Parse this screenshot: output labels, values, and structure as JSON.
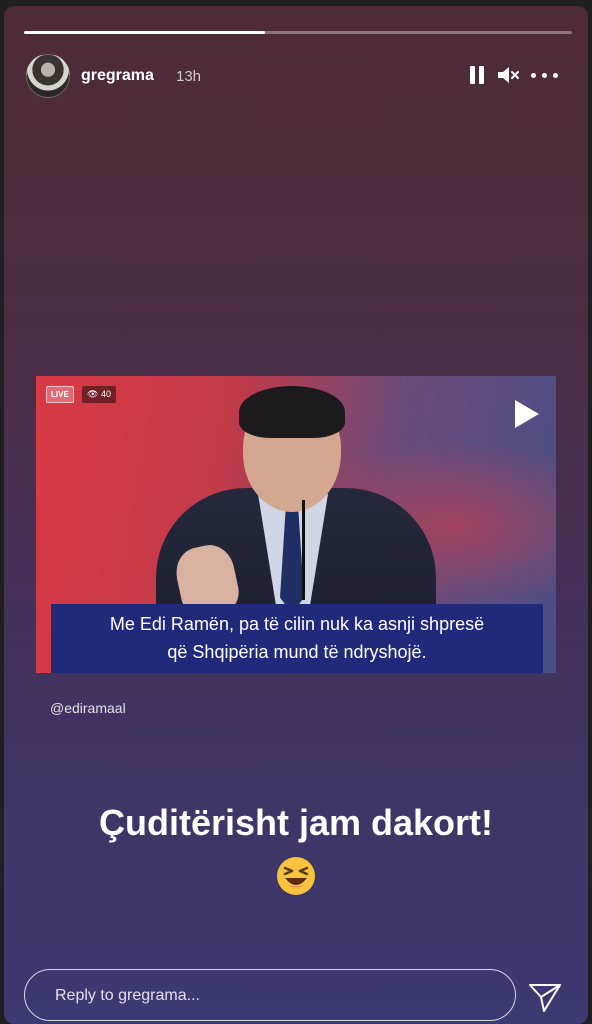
{
  "story": {
    "progress": 0.44,
    "username": "gregrama",
    "time_ago": "13h"
  },
  "video": {
    "live_label": "LIVE",
    "viewer_count": "40",
    "subtitle_line1": "Me Edi Ramën, pa të cilin nuk ka asnji shpresë",
    "subtitle_line2": "që Shqipëria mund të ndryshojë.",
    "mention": "@ediramaal"
  },
  "caption": "Çuditërisht jam dakort!",
  "emoji": "laughing-squint",
  "reply": {
    "placeholder": "Reply to gregrama..."
  },
  "icons": [
    "pause-icon",
    "mute-icon",
    "more-icon",
    "play-icon",
    "send-icon",
    "eye-icon"
  ]
}
